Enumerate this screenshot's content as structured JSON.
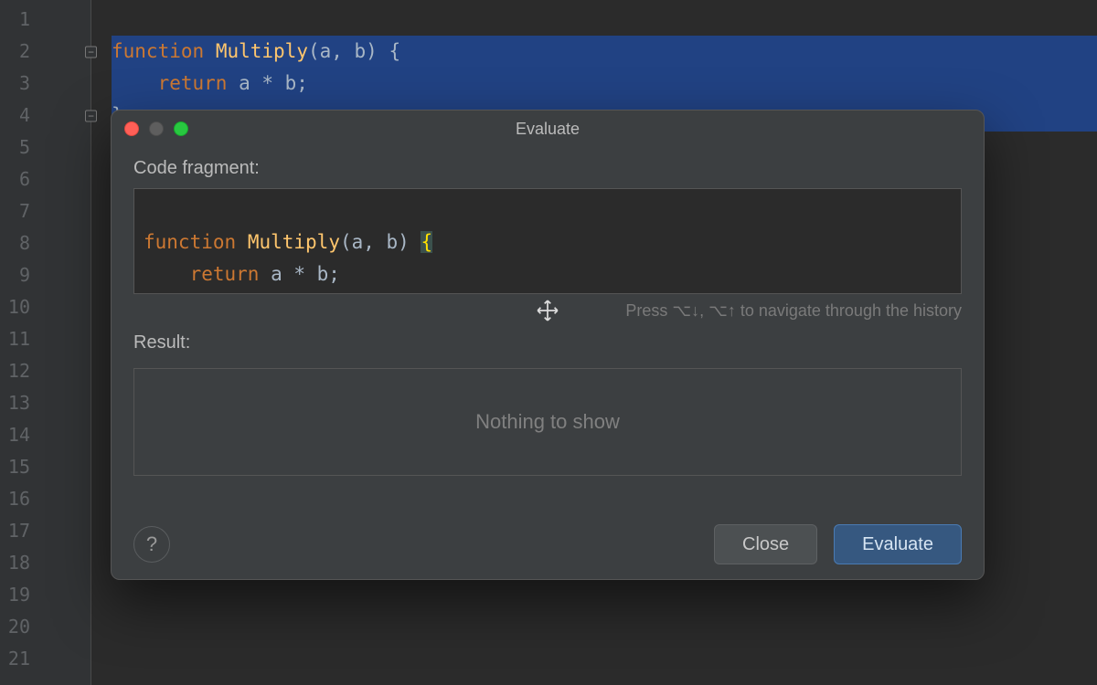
{
  "editor": {
    "lines": [
      "1",
      "2",
      "3",
      "4",
      "5",
      "6",
      "7",
      "8",
      "9",
      "10",
      "11",
      "12",
      "13",
      "14",
      "15",
      "16",
      "17",
      "18",
      "19",
      "20",
      "21"
    ],
    "code": {
      "fn_kw": "function",
      "fn_name": "Multiply",
      "params": "(a, b)",
      "open_brace": "{",
      "ret_kw": "return",
      "expr": "a * b;",
      "close_brace": "}"
    }
  },
  "dialog": {
    "title": "Evaluate",
    "fragment_label": "Code fragment:",
    "fragment": {
      "fn_kw": "function",
      "fn_name": "Multiply",
      "params": "(a, b)",
      "open_brace": "{",
      "ret_kw": "return",
      "expr": "a * b;",
      "close_brace": "}"
    },
    "history_hint": "Press ⌥↓, ⌥↑ to navigate through the history",
    "result_label": "Result:",
    "result_placeholder": "Nothing to show",
    "buttons": {
      "help": "?",
      "close": "Close",
      "evaluate": "Evaluate"
    }
  }
}
